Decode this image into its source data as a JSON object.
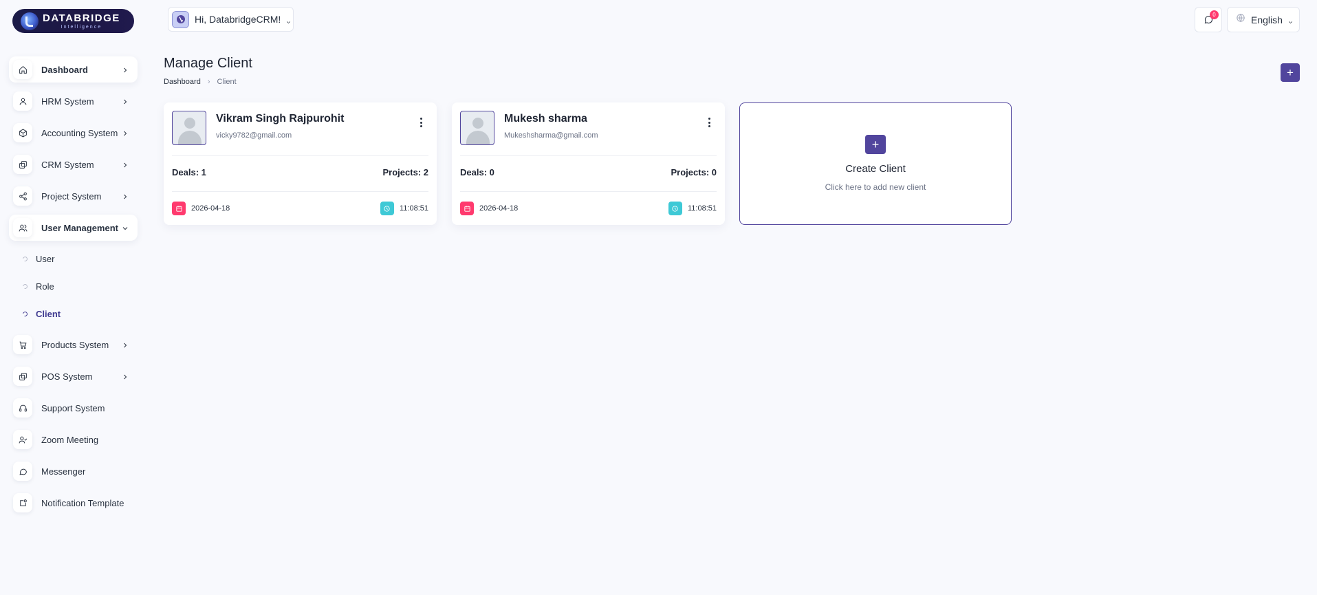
{
  "brand": {
    "title": "DATABRIDGE",
    "subtitle": "Intelligence"
  },
  "header": {
    "greeting": "Hi, DatabridgeCRM!",
    "notification_count": "0",
    "language": "English"
  },
  "sidebar": {
    "items": [
      {
        "label": "Dashboard",
        "icon": "home-icon",
        "has_arrow": true
      },
      {
        "label": "HRM System",
        "icon": "user-icon",
        "has_arrow": true
      },
      {
        "label": "Accounting System",
        "icon": "box-icon",
        "has_arrow": true
      },
      {
        "label": "CRM System",
        "icon": "layers-icon",
        "has_arrow": true
      },
      {
        "label": "Project System",
        "icon": "share-icon",
        "has_arrow": true
      },
      {
        "label": "User Management",
        "icon": "users-icon",
        "has_arrow": true,
        "expanded": true
      },
      {
        "label": "Products System",
        "icon": "cart-icon",
        "has_arrow": true
      },
      {
        "label": "POS System",
        "icon": "layers-icon",
        "has_arrow": true
      },
      {
        "label": "Support System",
        "icon": "headphones-icon",
        "has_arrow": false
      },
      {
        "label": "Zoom Meeting",
        "icon": "user-check-icon",
        "has_arrow": false
      },
      {
        "label": "Messenger",
        "icon": "message-icon",
        "has_arrow": false
      },
      {
        "label": "Notification Template",
        "icon": "notification-icon",
        "has_arrow": false
      }
    ],
    "sub_items": [
      {
        "label": "User"
      },
      {
        "label": "Role"
      },
      {
        "label": "Client"
      }
    ]
  },
  "page": {
    "title": "Manage Client",
    "breadcrumb": {
      "home": "Dashboard",
      "current": "Client"
    },
    "add_button": "+"
  },
  "clients": [
    {
      "name": "Vikram Singh Rajpurohit",
      "email": "vicky9782@gmail.com",
      "deals_label": "Deals: 1",
      "projects_label": "Projects: 2",
      "date": "2026-04-18",
      "time": "11:08:51"
    },
    {
      "name": "Mukesh sharma",
      "email": "Mukeshsharma@gmail.com",
      "deals_label": "Deals: 0",
      "projects_label": "Projects: 0",
      "date": "2026-04-18",
      "time": "11:08:51"
    }
  ],
  "create_card": {
    "plus": "+",
    "title": "Create Client",
    "subtitle": "Click here to add new client"
  },
  "colors": {
    "primary": "#51459d",
    "danger": "#ff3a6e",
    "info": "#3ec9d6",
    "background": "#f8f9fd"
  }
}
